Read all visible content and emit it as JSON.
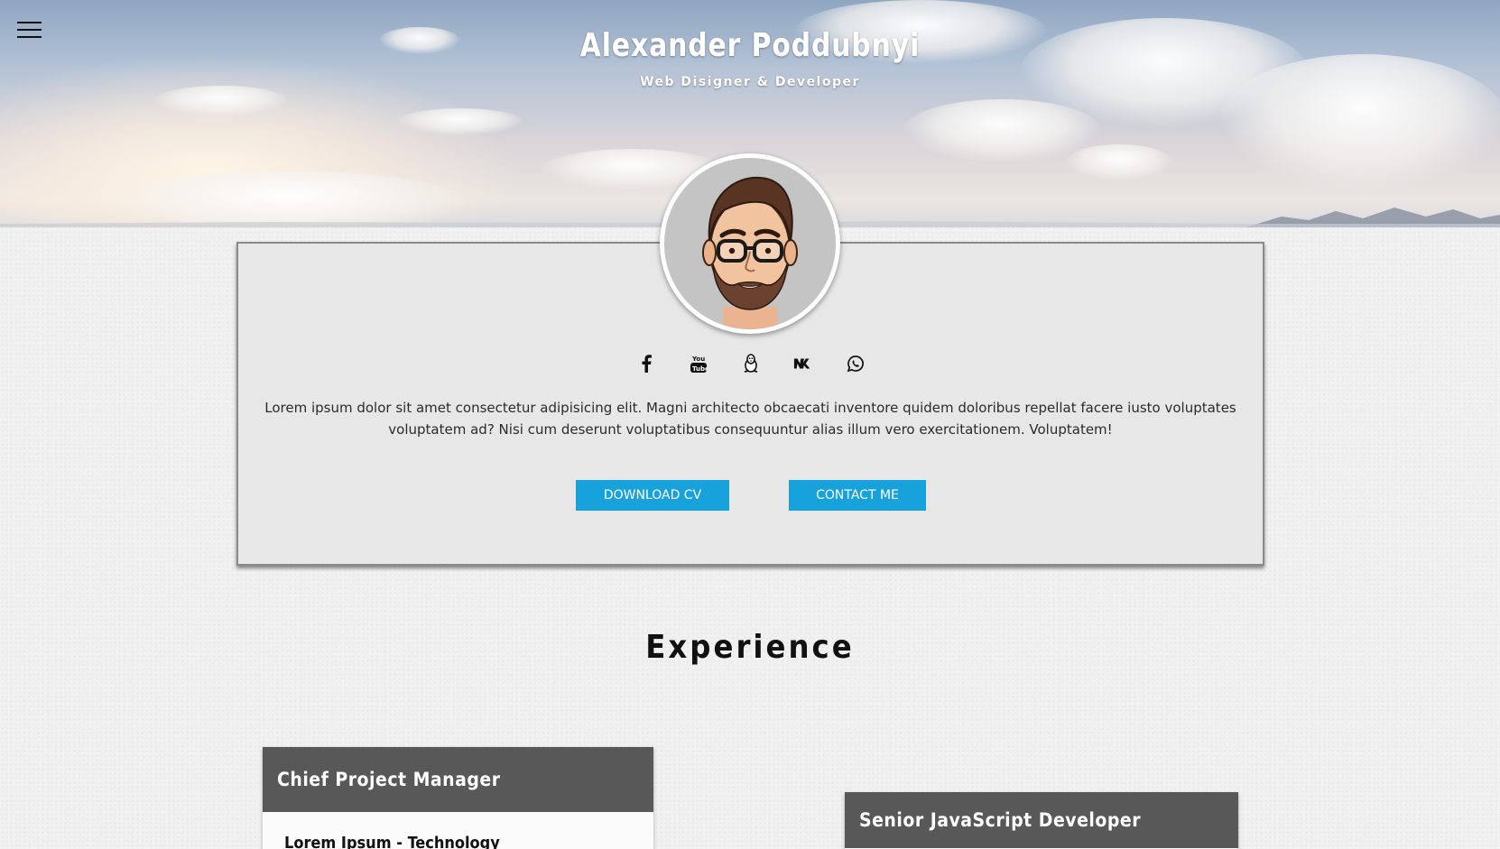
{
  "hero": {
    "title": "Alexander Poddubnyi",
    "subtitle": "Web Disigner & Developer"
  },
  "menu": {
    "icon": "hamburger-menu-icon"
  },
  "profile": {
    "avatar_alt": "avatar",
    "social": [
      {
        "name": "facebook-icon"
      },
      {
        "name": "youtube-icon"
      },
      {
        "name": "linux-icon"
      },
      {
        "name": "vk-icon"
      },
      {
        "name": "whatsapp-icon"
      }
    ],
    "description": "Lorem ipsum dolor sit amet consectetur adipisicing elit. Magni architecto obcaecati inventore quidem doloribus repellat facere iusto voluptates voluptatem ad? Nisi cum deserunt voluptatibus consequuntur alias illum vero exercitationem. Voluptatem!",
    "download_label": "DOWNLOAD CV",
    "contact_label": "CONTACT ME",
    "button_color": "#17a2dc"
  },
  "experience": {
    "title": "Experience",
    "items": [
      {
        "role": "Chief Project Manager",
        "company": "Lorem Ipsum - Technology"
      },
      {
        "role": "Senior JavaScript Developer",
        "company": ""
      }
    ]
  }
}
